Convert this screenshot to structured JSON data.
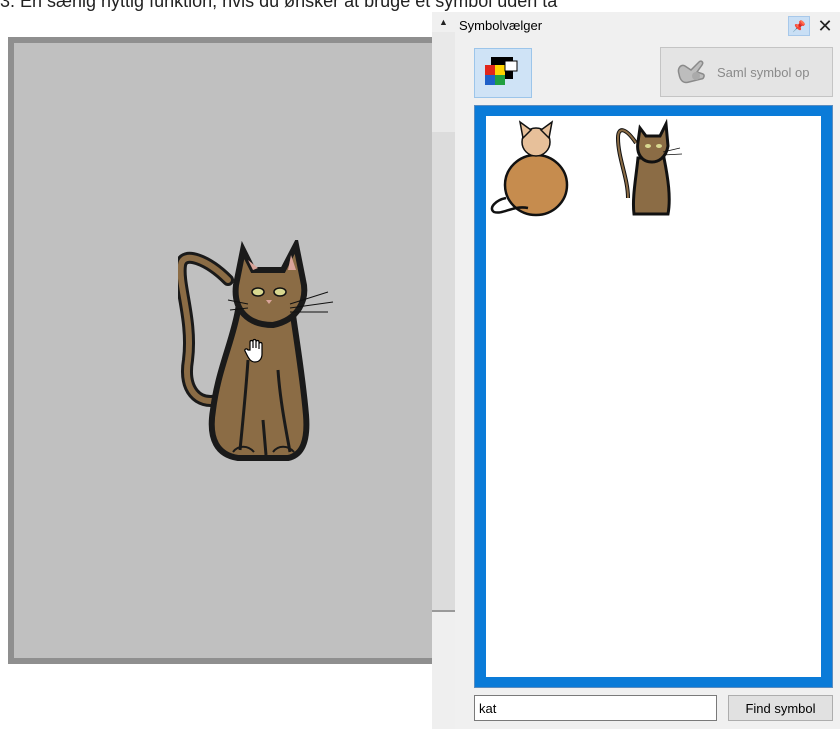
{
  "instruction_text": "3. En særlig nyttig funktion, hvis du ønsker at bruge et symbol uden ta",
  "symbol_panel": {
    "title": "Symbolvælger",
    "pin_icon": "pin-icon",
    "close_icon": "close-icon",
    "palette_icon": "color-palette-icon",
    "collect_button_label": "Saml symbol op",
    "collect_icon": "hand-grab-icon",
    "results": [
      {
        "name": "cat-simple"
      },
      {
        "name": "cat-detailed"
      }
    ],
    "search_value": "kat",
    "find_button_label": "Find symbol"
  },
  "canvas": {
    "symbol": "cat-large",
    "cursor": "hand-cursor-icon"
  },
  "colors": {
    "results_border": "#0a7bd8",
    "canvas_bg": "#c0c0c0",
    "cat_brown": "#8b6c45",
    "simple_cat": "#c68c4e"
  }
}
